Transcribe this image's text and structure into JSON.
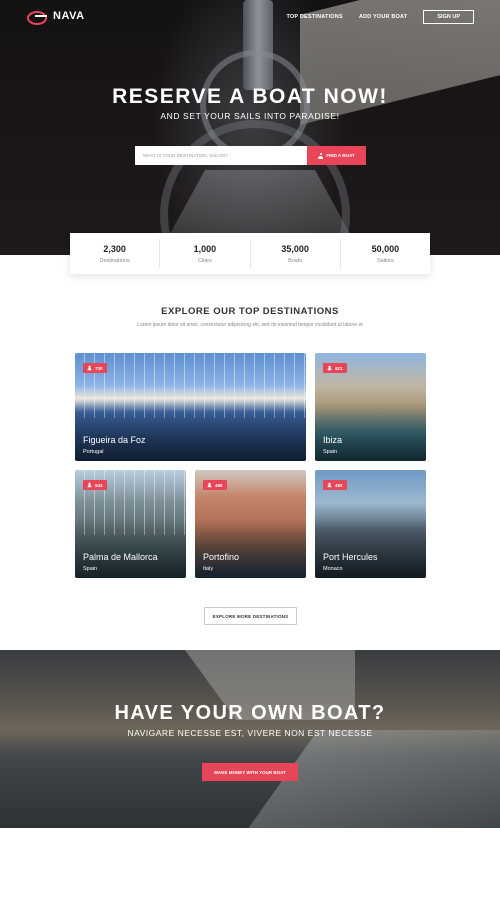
{
  "brand": {
    "name": "NAVA",
    "accent": "#e84558"
  },
  "nav": {
    "links": [
      "TOP DESTINATIONS",
      "ADD YOUR BOAT"
    ],
    "signup": "SIGN UP"
  },
  "hero": {
    "title": "RESERVE A BOAT NOW!",
    "subtitle": "AND SET YOUR SAILS INTO PARADISE!",
    "search_placeholder": "WHAT IS YOUR DESTINATION, SAILOR?",
    "find_button": "FIND A BOAT"
  },
  "stats": [
    {
      "value": "2,300",
      "label": "Destinations"
    },
    {
      "value": "1,000",
      "label": "Cities"
    },
    {
      "value": "35,000",
      "label": "Boats"
    },
    {
      "value": "50,000",
      "label": "Sailors"
    }
  ],
  "explore": {
    "title": "EXPLORE OUR TOP DESTINATIONS",
    "subtitle": "Lorem ipsum dolor sit amet, consectetur adipisicing elit, sed do eiusmod tempor incididunt ut labore et",
    "destinations": [
      {
        "city": "Figueira da Foz",
        "country": "Portugal",
        "count": "730"
      },
      {
        "city": "Ibiza",
        "country": "Spain",
        "count": "621"
      },
      {
        "city": "Palma de Mallorca",
        "country": "Spain",
        "count": "543"
      },
      {
        "city": "Portofino",
        "country": "Italy",
        "count": "495"
      },
      {
        "city": "Port Hercules",
        "country": "Monaco",
        "count": "492"
      }
    ],
    "more_button": "EXPLORE MORE DESTINATIONS"
  },
  "own_boat": {
    "title": "HAVE YOUR OWN BOAT?",
    "subtitle": "NAVIGARE NECESSE EST, VIVERE NON EST NECESSE",
    "button": "MAKE MONEY WITH YOUR BOAT"
  }
}
